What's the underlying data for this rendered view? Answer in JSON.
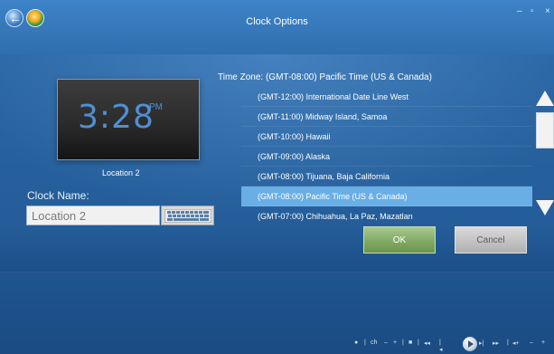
{
  "window": {
    "title": "Clock Options",
    "controls": [
      "–",
      "▫",
      "×"
    ]
  },
  "clock": {
    "time": "3:28",
    "ampm": "PM",
    "location_caption": "Location 2"
  },
  "clock_name": {
    "label": "Clock Name:",
    "value": "Location 2",
    "keyboard_icon": "keyboard-icon"
  },
  "timezone": {
    "header": "Time Zone: (GMT-08:00) Pacific Time (US & Canada)",
    "items": [
      "(GMT-12:00) International Date Line West",
      "(GMT-11:00) Midway Island, Samoa",
      "(GMT-10:00) Hawaii",
      "(GMT-09:00) Alaska",
      "(GMT-08:00) Tijuana, Baja California",
      "(GMT-08:00) Pacific Time (US & Canada)",
      "(GMT-07:00) Chihuahua, La Paz, Mazatlan"
    ],
    "selected_index": 5
  },
  "buttons": {
    "ok": "OK",
    "cancel": "Cancel"
  },
  "transport": {
    "items": [
      "●",
      "|",
      "ch",
      "–",
      "+",
      "|",
      "■",
      "|",
      "◂◂",
      "|◂",
      "▸|",
      "▸▸",
      "|",
      "◂+",
      "–",
      "+"
    ]
  },
  "colors": {
    "background": "#2a5f99",
    "selected_row": "#6aaee6",
    "ok_button": "#82aa64",
    "clock_digits": "#4f8fd6"
  }
}
